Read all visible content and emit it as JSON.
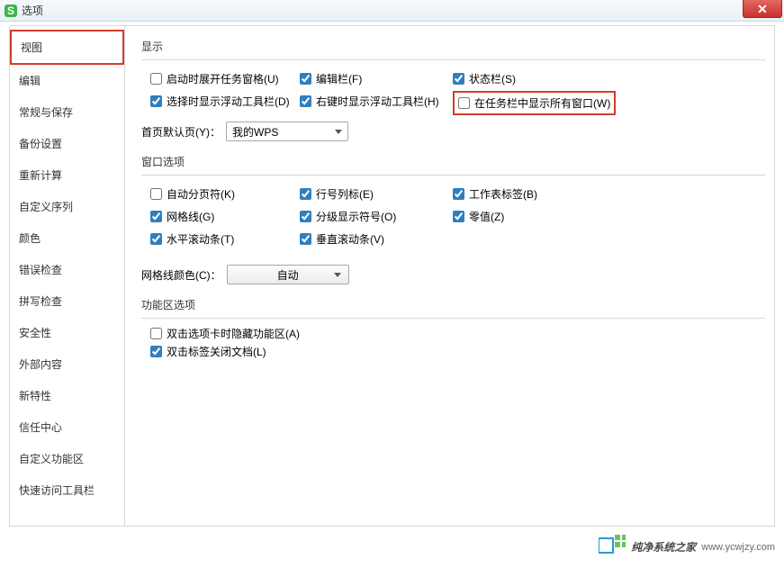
{
  "window": {
    "title": "选项"
  },
  "sidebar": {
    "items": [
      {
        "label": "视图",
        "selected": true
      },
      {
        "label": "编辑"
      },
      {
        "label": "常规与保存"
      },
      {
        "label": "备份设置"
      },
      {
        "label": "重新计算"
      },
      {
        "label": "自定义序列"
      },
      {
        "label": "颜色"
      },
      {
        "label": "错误检查"
      },
      {
        "label": "拼写检查"
      },
      {
        "label": "安全性"
      },
      {
        "label": "外部内容"
      },
      {
        "label": "新特性"
      },
      {
        "label": "信任中心"
      },
      {
        "label": "自定义功能区"
      },
      {
        "label": "快速访问工具栏"
      }
    ]
  },
  "sections": {
    "display": {
      "title": "显示",
      "rows": [
        [
          {
            "label": "启动时展开任务窗格(U)",
            "checked": false
          },
          {
            "label": "编辑栏(F)",
            "checked": true
          },
          {
            "label": "状态栏(S)",
            "checked": true
          }
        ],
        [
          {
            "label": "选择时显示浮动工具栏(D)",
            "checked": true
          },
          {
            "label": "右键时显示浮动工具栏(H)",
            "checked": true
          },
          {
            "label": "在任务栏中显示所有窗口(W)",
            "checked": false,
            "highlight": true
          }
        ]
      ],
      "defaultTab": {
        "label": "首页默认页(Y)：",
        "value": "我的WPS"
      }
    },
    "winopts": {
      "title": "窗口选项",
      "rows": [
        [
          {
            "label": "自动分页符(K)",
            "checked": false
          },
          {
            "label": "行号列标(E)",
            "checked": true
          },
          {
            "label": "工作表标签(B)",
            "checked": true
          }
        ],
        [
          {
            "label": "网格线(G)",
            "checked": true
          },
          {
            "label": "分级显示符号(O)",
            "checked": true
          },
          {
            "label": "零值(Z)",
            "checked": true
          }
        ],
        [
          {
            "label": "水平滚动条(T)",
            "checked": true
          },
          {
            "label": "垂直滚动条(V)",
            "checked": true
          }
        ]
      ],
      "gridColor": {
        "label": "网格线颜色(C)：",
        "value": "自动"
      }
    },
    "ribbon": {
      "title": "功能区选项",
      "items": [
        {
          "label": "双击选项卡时隐藏功能区(A)",
          "checked": false
        },
        {
          "label": "双击标签关闭文档(L)",
          "checked": true
        }
      ]
    }
  },
  "watermark": {
    "text": "纯净系统之家",
    "url": "www.ycwjzy.com"
  }
}
